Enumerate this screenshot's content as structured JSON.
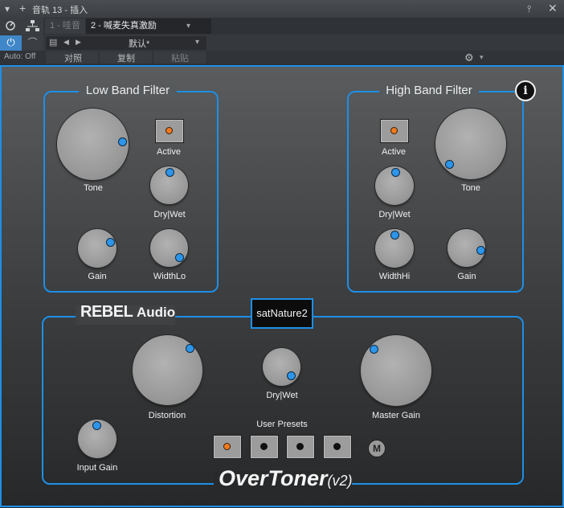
{
  "window": {
    "title": "音轨 13 - 插入"
  },
  "header": {
    "tabs": [
      {
        "label": "1 - 哇音"
      },
      {
        "label": "2 - 喊麦失真激励"
      }
    ],
    "preset": "默认*",
    "auto": "Auto: Off",
    "actions": [
      "对照",
      "复制",
      "粘贴"
    ]
  },
  "plugin": {
    "low_band": {
      "title": "Low Band Filter",
      "tone": "Tone",
      "active": "Active",
      "drywet": "Dry|Wet",
      "gain": "Gain",
      "width": "WidthLo"
    },
    "high_band": {
      "title": "High Band Filter",
      "active": "Active",
      "tone": "Tone",
      "drywet": "Dry|Wet",
      "width": "WidthHi",
      "gain": "Gain"
    },
    "brand": {
      "name": "REBEL",
      "suffix": "Audio"
    },
    "preset_name": "satNature2",
    "main": {
      "distortion": "Distortion",
      "drywet": "Dry|Wet",
      "master": "Master Gain",
      "input": "Input Gain",
      "user_presets": "User Presets",
      "m_label": "M"
    },
    "product": {
      "name": "OverToner",
      "version": "(v2)"
    },
    "info": "i",
    "user_preset_states": [
      true,
      false,
      false,
      false
    ]
  }
}
